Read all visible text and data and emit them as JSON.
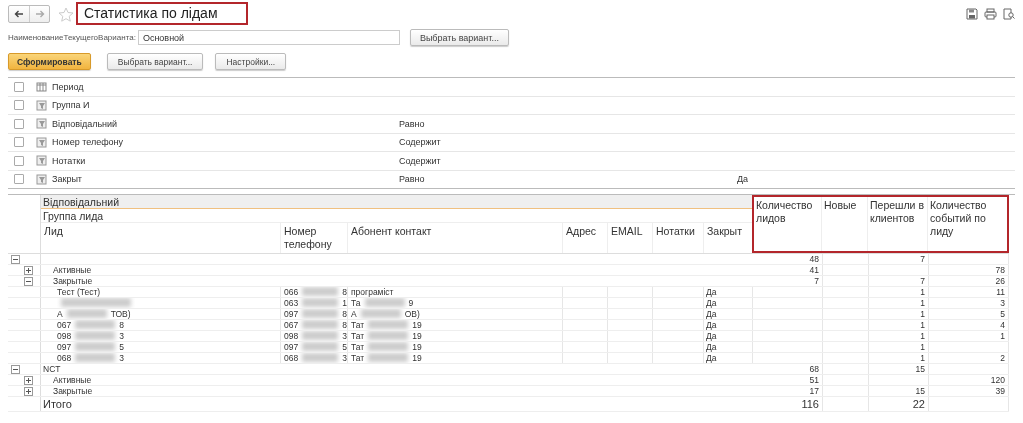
{
  "window": {
    "title": "Статистика по лідам"
  },
  "variant": {
    "label": "НаименованиеТекущегоВарианта:",
    "value": "Основной",
    "button": "Выбрать вариант..."
  },
  "toolbar": [
    {
      "label": "Сформировать",
      "kind": "primary"
    },
    {
      "label": "Выбрать вариант...",
      "kind": "normal"
    },
    {
      "label": "Настройки...",
      "kind": "normal"
    }
  ],
  "filters": [
    {
      "field": "Период",
      "kind": "period",
      "checked": false
    },
    {
      "field": "Группа И",
      "kind": "field",
      "checked": false
    },
    {
      "field": "Відповідальний",
      "kind": "field",
      "checked": false,
      "condition": "Равно"
    },
    {
      "field": "Номер телефону",
      "kind": "field",
      "checked": false,
      "condition": "Содержит"
    },
    {
      "field": "Нотатки",
      "kind": "field",
      "checked": false,
      "condition": "Содержит"
    },
    {
      "field": "Закрыт",
      "kind": "field",
      "checked": false,
      "condition": "Равно",
      "value": "Да"
    }
  ],
  "report": {
    "grouping": [
      "Відповідальний",
      "Группа лида"
    ],
    "columns": [
      "Лид",
      "Номер телефону",
      "Абонент контакт",
      "Адрес",
      "EMAIL",
      "Нотатки",
      "Закрыт"
    ],
    "measures": [
      "Количество лидов",
      "Новые",
      "Перешли в клиентов",
      "Количество событий по лиду"
    ],
    "rows": [
      {
        "kind": "group",
        "expanded": true,
        "values": {
          "leads": "48",
          "converted": "7"
        },
        "children": [
          {
            "kind": "group",
            "label": "Активные",
            "expanded": false,
            "values": {
              "leads": "41",
              "events": "78"
            }
          },
          {
            "kind": "group",
            "label": "Закрытые",
            "expanded": true,
            "values": {
              "leads": "7",
              "converted": "7",
              "events": "26"
            },
            "children": [
              {
                "kind": "lead",
                "lead": {
                  "start": "Тест (Тест)"
                },
                "phone": {
                  "start": "066",
                  "end": "8"
                },
                "contact": {
                  "start": "програміст"
                },
                "closed": "Да",
                "values": {
                  "converted": "1",
                  "events": "11"
                }
              },
              {
                "kind": "lead",
                "phone": {
                  "start": "063",
                  "end": "1"
                },
                "contact": {
                  "start": "Та",
                  "end": "9"
                },
                "closed": "Да",
                "values": {
                  "converted": "1",
                  "events": "3"
                }
              },
              {
                "kind": "lead",
                "lead": {
                  "start": "А",
                  "end": "ТОВ)"
                },
                "phone": {
                  "start": "097",
                  "end": "8"
                },
                "contact": {
                  "start": "А",
                  "end": "ОВ)"
                },
                "closed": "Да",
                "values": {
                  "converted": "1",
                  "events": "5"
                }
              },
              {
                "kind": "lead",
                "lead": {
                  "start": "067",
                  "end": "8"
                },
                "phone": {
                  "start": "067",
                  "end": "8"
                },
                "contact": {
                  "start": "Тат",
                  "end": "19"
                },
                "closed": "Да",
                "values": {
                  "converted": "1",
                  "events": "4"
                }
              },
              {
                "kind": "lead",
                "lead": {
                  "start": "098",
                  "end": "3"
                },
                "phone": {
                  "start": "098",
                  "end": "3"
                },
                "contact": {
                  "start": "Тат",
                  "end": "19"
                },
                "closed": "Да",
                "values": {
                  "converted": "1",
                  "events": "1"
                }
              },
              {
                "kind": "lead",
                "lead": {
                  "start": "097",
                  "end": "5"
                },
                "phone": {
                  "start": "097",
                  "end": "5"
                },
                "contact": {
                  "start": "Тат",
                  "end": "19"
                },
                "closed": "Да",
                "values": {
                  "converted": "1"
                }
              },
              {
                "kind": "lead",
                "lead": {
                  "start": "068",
                  "end": "3"
                },
                "phone": {
                  "start": "068",
                  "end": "3"
                },
                "contact": {
                  "start": "Тат",
                  "end": "19"
                },
                "closed": "Да",
                "values": {
                  "converted": "1",
                  "events": "2"
                }
              }
            ]
          }
        ]
      },
      {
        "kind": "group",
        "label": "NCT",
        "expanded": true,
        "values": {
          "leads": "68",
          "converted": "15"
        },
        "children": [
          {
            "kind": "group",
            "label": "Активные",
            "expanded": false,
            "values": {
              "leads": "51",
              "events": "120"
            }
          },
          {
            "kind": "group",
            "label": "Закрытые",
            "expanded": false,
            "values": {
              "leads": "17",
              "converted": "15",
              "events": "39"
            }
          }
        ]
      }
    ],
    "total": {
      "label": "Итого",
      "values": {
        "leads": "116",
        "converted": "22"
      }
    }
  }
}
